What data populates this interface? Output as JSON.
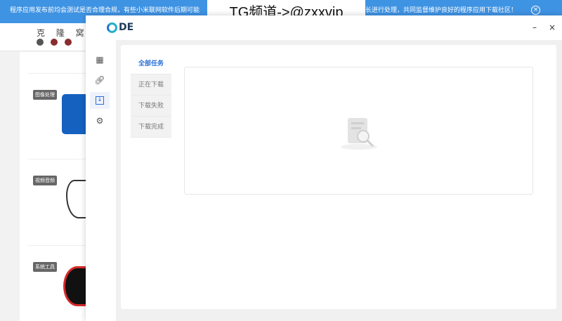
{
  "banner": {
    "text_left": "程序应用发布前均会测试是否合理合规，有些小米联网软件后期可能",
    "text_right": "长进行处理，共同监督维护良好的程序应用下载社区！",
    "close_icon": "circle-x-icon"
  },
  "watermark": "TG频道->@zxxvip",
  "site": {
    "logo": "克 隆 窝",
    "tags": [
      "图像处理",
      "视频音频",
      "系统工具"
    ]
  },
  "dialog": {
    "logo": "DE",
    "minimize": "–",
    "close": "×",
    "sidebar": [
      {
        "icon": "grid-icon"
      },
      {
        "icon": "link-icon"
      },
      {
        "icon": "download-icon",
        "active": true
      },
      {
        "icon": "gear-icon"
      }
    ],
    "tabs": [
      {
        "label": "全部任务",
        "active": true
      },
      {
        "label": "正在下载"
      },
      {
        "label": "下载失败"
      },
      {
        "label": "下载完成"
      }
    ],
    "accent": "#2a6fd6"
  }
}
